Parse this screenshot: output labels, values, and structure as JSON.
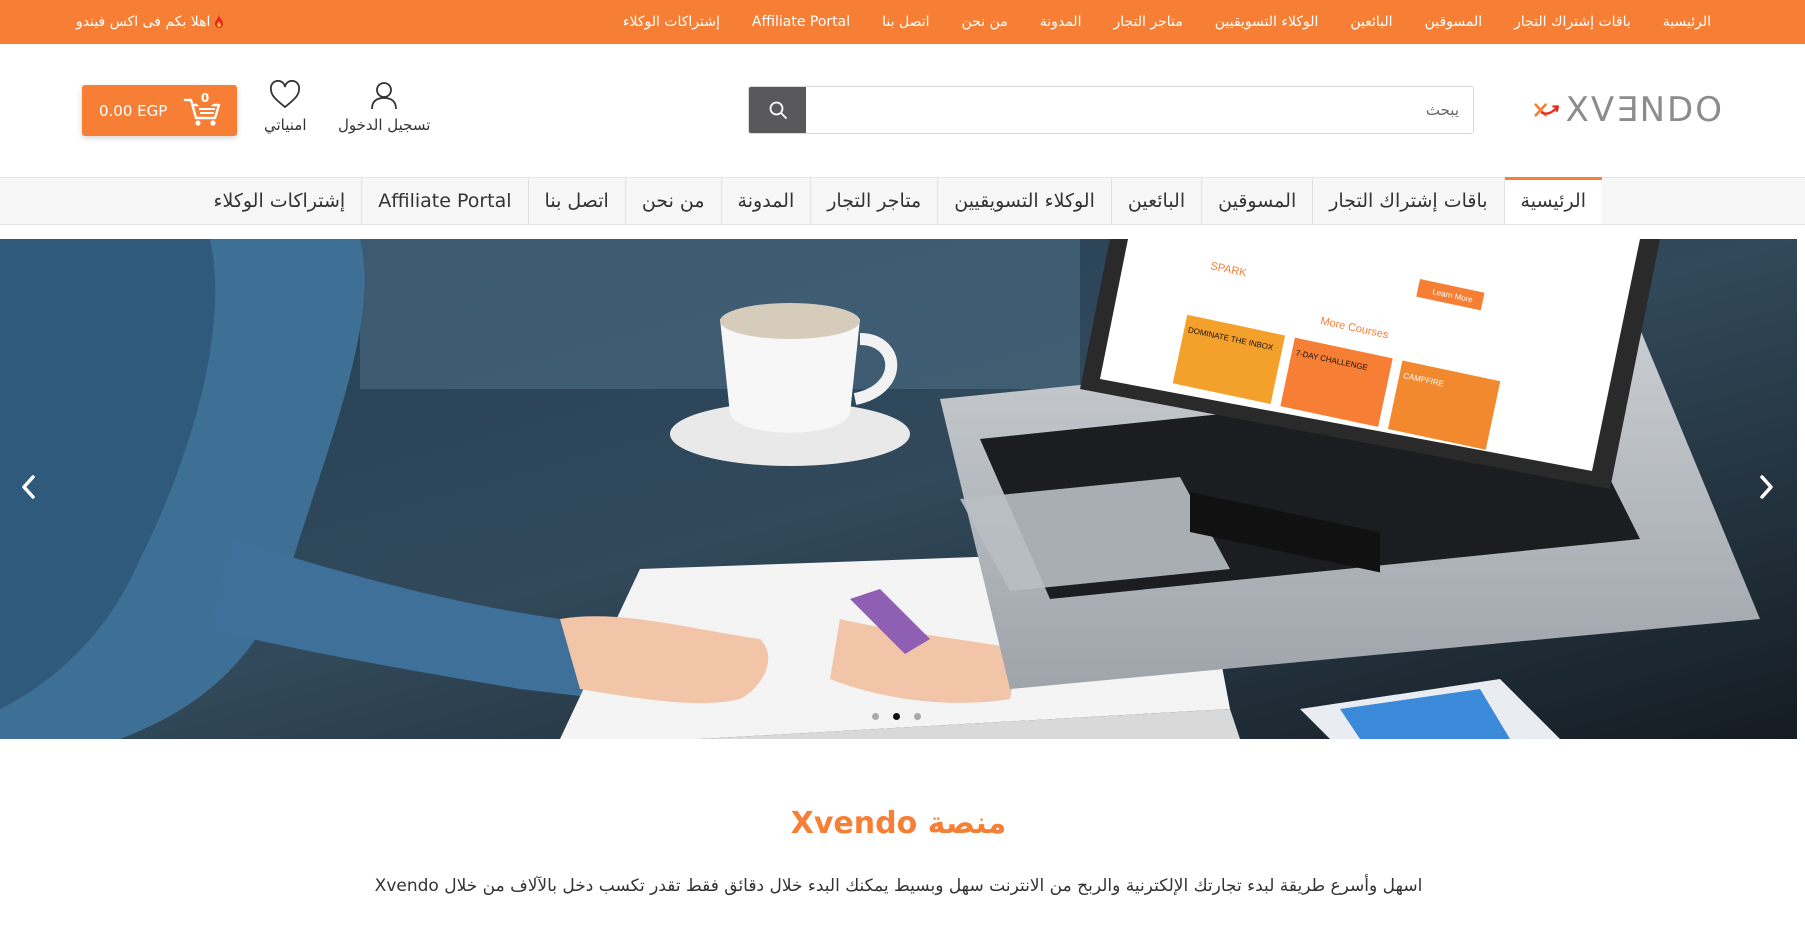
{
  "topbar": {
    "welcome": "اهلا بكم فى اكس فيندو",
    "links": [
      "الرئيسية",
      "باقات إشتراك التجار",
      "المسوقين",
      "البائعين",
      "الوكلاء التسويقيين",
      "متاجر التجار",
      "المدونة",
      "من نحن",
      "اتصل بنا",
      "Affiliate Portal",
      "إشتراكات الوكلاء"
    ]
  },
  "header": {
    "logo_text": "XV∃NDO",
    "search_placeholder": "يبحث",
    "login_label": "تسجيل الدخول",
    "wishlist_label": "امنياتي",
    "cart_total": "0.00 EGP",
    "cart_count": "0"
  },
  "mainnav": {
    "items": [
      "الرئيسية",
      "باقات إشتراك التجار",
      "المسوقين",
      "البائعين",
      "الوكلاء التسويقيين",
      "متاجر التجار",
      "المدونة",
      "من نحن",
      "اتصل بنا",
      "Affiliate Portal",
      "إشتراكات الوكلاء"
    ],
    "active_index": 0
  },
  "hero": {
    "screen_brand": "SPARK",
    "screen_heading": "More Courses",
    "screen_cards": [
      "DOMINATE THE INBOX",
      "7-DAY CHALLENGE",
      "CAMPFIRE"
    ],
    "screen_button": "Learn More",
    "slides": 3,
    "active_slide": 1
  },
  "intro": {
    "title": "منصة Xvendo",
    "text": "اسهل وأسرع طريقة لبدء تجارتك الإلكترنية والربح من الانترنت سهل وبسيط يمكنك البدء خلال دقائق فقط تقدر تكسب دخل بالآلاف من خلال Xvendo"
  },
  "colors": {
    "accent": "#f67f35",
    "search_button": "#59595c",
    "nav_bg": "#f7f7f7"
  }
}
